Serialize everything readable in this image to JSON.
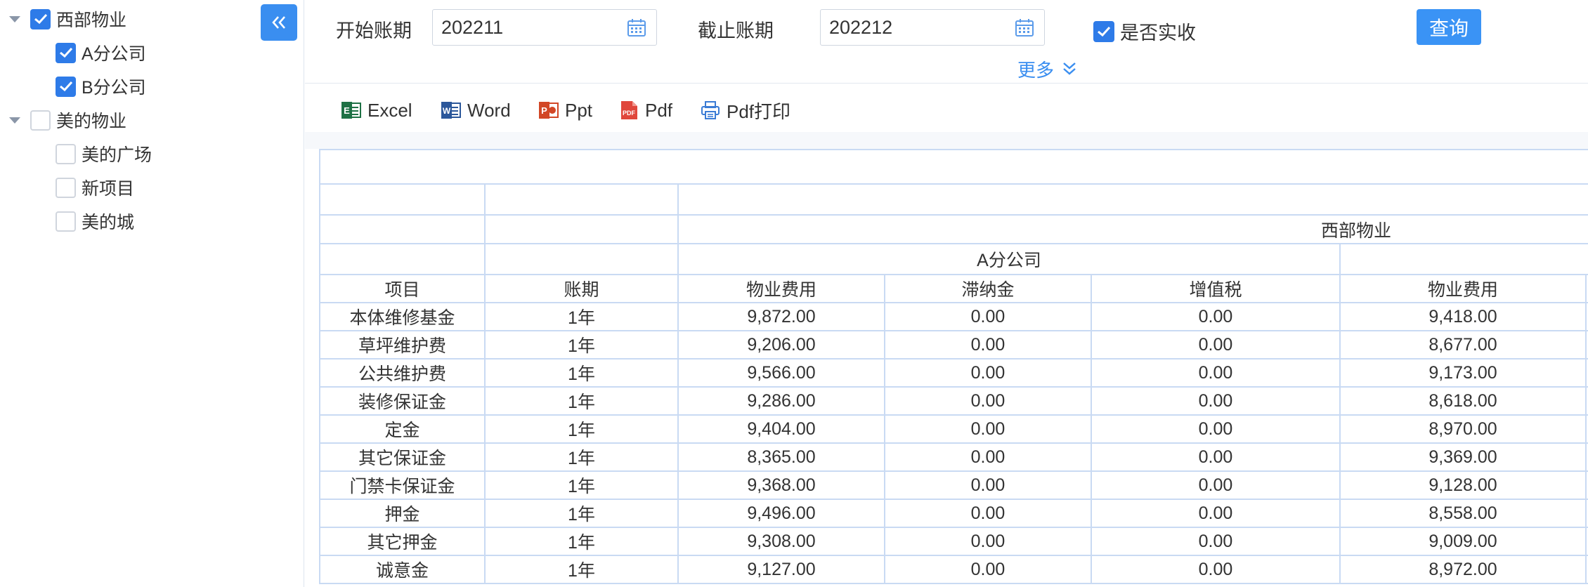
{
  "sidebar": {
    "tree": [
      {
        "label": "西部物业",
        "checked": true,
        "level": 0,
        "expanded": true
      },
      {
        "label": "A分公司",
        "checked": true,
        "level": 1
      },
      {
        "label": "B分公司",
        "checked": true,
        "level": 1
      },
      {
        "label": "美的物业",
        "checked": false,
        "level": 0,
        "expanded": true
      },
      {
        "label": "美的广场",
        "checked": false,
        "level": 1
      },
      {
        "label": "新项目",
        "checked": false,
        "level": 1
      },
      {
        "label": "美的城",
        "checked": false,
        "level": 1
      }
    ],
    "collapse_icon": "double-chevron-left-icon"
  },
  "filters": {
    "start_label": "开始账期",
    "start_value": "202211",
    "end_label": "截止账期",
    "end_value": "202212",
    "received_label": "是否实收",
    "received_checked": true,
    "query_label": "查询",
    "more_label": "更多"
  },
  "toolbar": {
    "excel": "Excel",
    "word": "Word",
    "ppt": "Ppt",
    "pdf": "Pdf",
    "pdf_print": "Pdf打印"
  },
  "report": {
    "group_label": "西部物业",
    "subgroup_label": "A分公司",
    "col_item": "项目",
    "col_period": "账期",
    "cols": [
      "物业费用",
      "滞纳金",
      "增值税",
      "物业费用"
    ],
    "rows": [
      {
        "item": "本体维修基金",
        "period": "1年",
        "v": [
          "9,872.00",
          "0.00",
          "0.00",
          "9,418.00"
        ]
      },
      {
        "item": "草坪维护费",
        "period": "1年",
        "v": [
          "9,206.00",
          "0.00",
          "0.00",
          "8,677.00"
        ]
      },
      {
        "item": "公共维护费",
        "period": "1年",
        "v": [
          "9,566.00",
          "0.00",
          "0.00",
          "9,173.00"
        ]
      },
      {
        "item": "装修保证金",
        "period": "1年",
        "v": [
          "9,286.00",
          "0.00",
          "0.00",
          "8,618.00"
        ]
      },
      {
        "item": "定金",
        "period": "1年",
        "v": [
          "9,404.00",
          "0.00",
          "0.00",
          "8,970.00"
        ]
      },
      {
        "item": "其它保证金",
        "period": "1年",
        "v": [
          "8,365.00",
          "0.00",
          "0.00",
          "9,369.00"
        ]
      },
      {
        "item": "门禁卡保证金",
        "period": "1年",
        "v": [
          "9,368.00",
          "0.00",
          "0.00",
          "9,128.00"
        ]
      },
      {
        "item": "押金",
        "period": "1年",
        "v": [
          "9,496.00",
          "0.00",
          "0.00",
          "8,558.00"
        ]
      },
      {
        "item": "其它押金",
        "period": "1年",
        "v": [
          "9,308.00",
          "0.00",
          "0.00",
          "9,009.00"
        ]
      },
      {
        "item": "诚意金",
        "period": "1年",
        "v": [
          "9,127.00",
          "0.00",
          "0.00",
          "8,972.00"
        ]
      }
    ]
  },
  "colors": {
    "accent": "#3a8ef0",
    "checkbox": "#2e7be8",
    "table_border": "#c9daf3"
  }
}
